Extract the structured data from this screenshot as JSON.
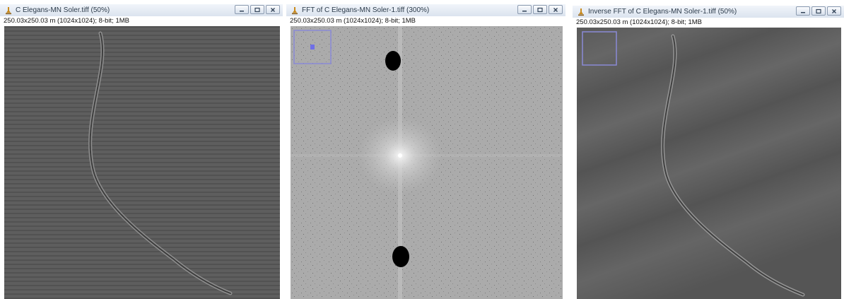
{
  "windows": [
    {
      "title": "C Elegans-MN Soler.tiff (50%)",
      "info": "250.03x250.03 m (1024x1024); 8-bit; 1MB"
    },
    {
      "title": "FFT of C Elegans-MN Soler-1.tiff (300%)",
      "info": "250.03x250.03 m (1024x1024); 8-bit; 1MB"
    },
    {
      "title": "Inverse FFT of C Elegans-MN Soler-1.tiff (50%)",
      "info": "250.03x250.03 m (1024x1024); 8-bit; 1MB"
    }
  ],
  "colors": {
    "titlebar": "#dbe4ef",
    "micrograph_bg": "#5c5c5c",
    "fft_bg": "#a9a9a9",
    "mask_spot": "#000000",
    "roi_outline": "#7b7bdc"
  },
  "icons": [
    "microscope-app-icon",
    "minimize-icon",
    "maximize-icon",
    "close-icon"
  ]
}
